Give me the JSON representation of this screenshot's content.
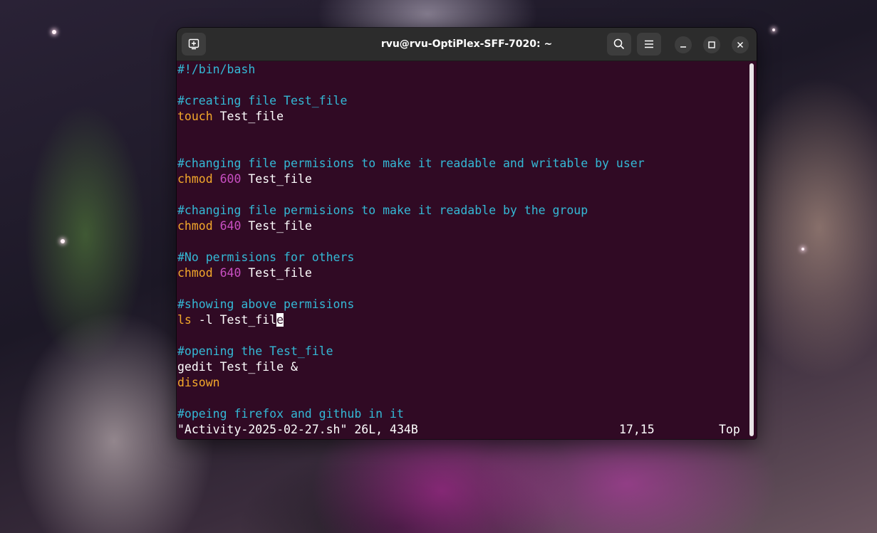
{
  "window": {
    "title": "rvu@rvu-OptiPlex-SFF-7020: ~",
    "icons": {
      "new_tab": "new-tab-icon",
      "search": "search-icon",
      "menu": "hamburger-menu-icon",
      "minimize": "minimize-icon",
      "maximize": "maximize-icon",
      "close": "close-icon"
    }
  },
  "editor": {
    "lines": [
      {
        "t": "c",
        "text": "#!/bin/bash"
      },
      {
        "t": "blank"
      },
      {
        "t": "c",
        "text": "#creating file Test_file"
      },
      {
        "t": "cmd",
        "cmd": "touch",
        "arg": "",
        "rest": " Test_file"
      },
      {
        "t": "blank"
      },
      {
        "t": "blank"
      },
      {
        "t": "c",
        "text": "#changing file permisions to make it readable and writable by user"
      },
      {
        "t": "cmd",
        "cmd": "chmod",
        "arg": " 600",
        "rest": " Test_file"
      },
      {
        "t": "blank"
      },
      {
        "t": "c",
        "text": "#changing file permisions to make it readable by the group"
      },
      {
        "t": "cmd",
        "cmd": "chmod",
        "arg": " 640",
        "rest": " Test_file"
      },
      {
        "t": "blank"
      },
      {
        "t": "c",
        "text": "#No permisions for others"
      },
      {
        "t": "cmd",
        "cmd": "chmod",
        "arg": " 640",
        "rest": " Test_file"
      },
      {
        "t": "blank"
      },
      {
        "t": "c",
        "text": "#showing above permisions"
      },
      {
        "t": "cursor",
        "cmd": "ls",
        "rest_before": " -l Test_fil",
        "cursor_char": "e"
      },
      {
        "t": "blank"
      },
      {
        "t": "c",
        "text": "#opening the Test_file"
      },
      {
        "t": "plain",
        "text": "gedit Test_file &"
      },
      {
        "t": "cmd",
        "cmd": "disown",
        "arg": "",
        "rest": ""
      },
      {
        "t": "blank"
      },
      {
        "t": "c",
        "text": "#opeing firefox and github in it"
      }
    ]
  },
  "status": {
    "file": "\"Activity-2025-02-27.sh\" 26L, 434B",
    "position": "17,15",
    "scroll": "Top"
  },
  "colors": {
    "background": "#300a24",
    "comment": "#34b9d6",
    "keyword": "#f3a82b",
    "number": "#c84fc2",
    "text": "#ffffff"
  }
}
